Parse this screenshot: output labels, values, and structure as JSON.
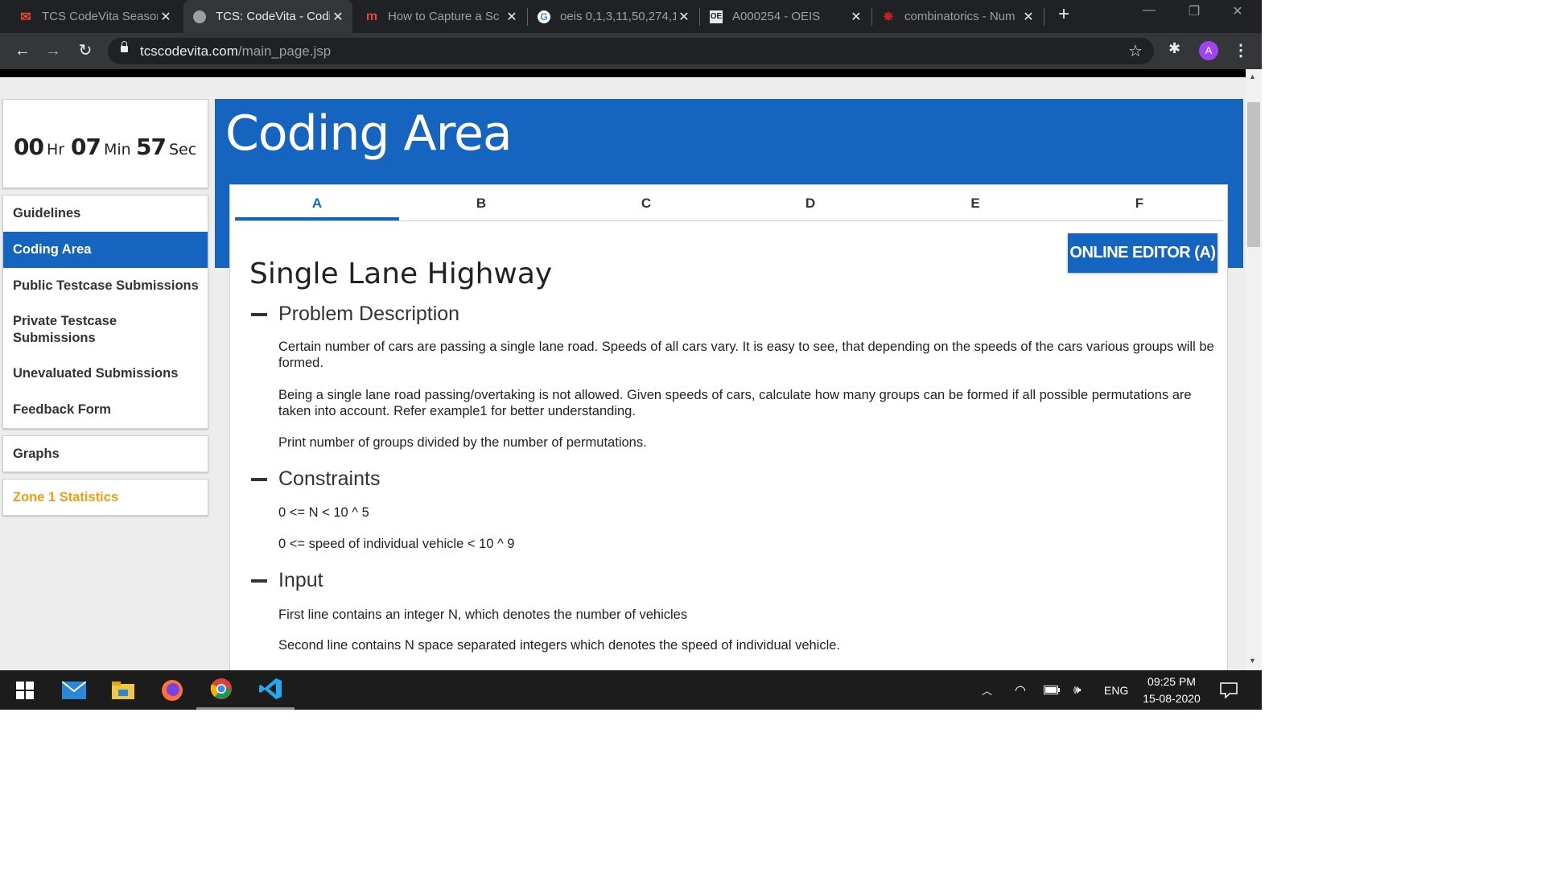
{
  "browser": {
    "tabs": [
      {
        "title": "TCS CodeVita Season",
        "favicon": "gmail-icon"
      },
      {
        "title": "TCS: CodeVita - Codi",
        "favicon": "globe-icon",
        "active": true
      },
      {
        "title": "How to Capture a Sc",
        "favicon": "m-icon"
      },
      {
        "title": "oeis 0,1,3,11,50,274,1",
        "favicon": "google-icon"
      },
      {
        "title": "A000254 - OEIS",
        "favicon": "oeis-icon"
      },
      {
        "title": "combinatorics - Num",
        "favicon": "mathse-icon"
      }
    ],
    "url_domain": "tcscodevita.com",
    "url_path": "/main_page.jsp",
    "profile_initial": "A"
  },
  "timer": {
    "hours": "00",
    "hours_unit": "Hr",
    "minutes": "07",
    "minutes_unit": "Min",
    "seconds": "57",
    "seconds_unit": "Sec"
  },
  "sidebar": {
    "items": [
      {
        "label": "Guidelines"
      },
      {
        "label": "Coding Area",
        "active": true
      },
      {
        "label": "Public Testcase Submissions"
      },
      {
        "label": "Private Testcase Submissions"
      },
      {
        "label": "Unevaluated Submissions"
      },
      {
        "label": "Feedback Form"
      }
    ],
    "graphs": "Graphs",
    "zone_stats": "Zone 1 Statistics"
  },
  "main": {
    "title": "Coding Area",
    "problem_tabs": [
      "A",
      "B",
      "C",
      "D",
      "E",
      "F"
    ],
    "active_tab": "A",
    "editor_button": "ONLINE EDITOR (A)",
    "problem_title": "Single Lane Highway",
    "sections": {
      "description": {
        "heading": "Problem Description",
        "paragraphs": [
          "Certain number of cars are passing a single lane road. Speeds of all cars vary. It is easy to see, that depending on the speeds of the cars various groups will be formed.",
          "Being a single lane road passing/overtaking is not allowed. Given speeds of cars, calculate how many groups can be formed if all possible permutations are taken into account. Refer example1 for better understanding.",
          "Print number of groups divided by the number of permutations."
        ]
      },
      "constraints": {
        "heading": "Constraints",
        "lines": [
          "0 <= N < 10 ^ 5",
          "0 <= speed of individual vehicle < 10 ^ 9"
        ]
      },
      "input": {
        "heading": "Input",
        "lines": [
          "First line contains an integer N, which denotes the number of vehicles",
          "Second line contains N space separated integers which denotes the speed of individual vehicle."
        ]
      }
    }
  },
  "taskbar": {
    "apps": [
      "start-icon",
      "mail-icon",
      "file-explorer-icon",
      "firefox-icon",
      "chrome-icon",
      "vscode-icon"
    ],
    "language": "ENG",
    "time": "09:25 PM",
    "date": "15-08-2020"
  }
}
